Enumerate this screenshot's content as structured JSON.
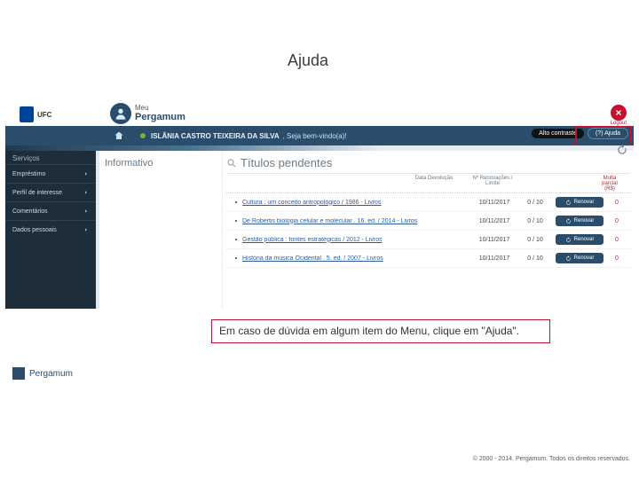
{
  "callout_title": "Ajuda",
  "topbar": {
    "org_code": "UFC",
    "meu_label": "Meu",
    "brand": "Pergamum",
    "logout_label": "Logout"
  },
  "userbar": {
    "user_name": "ISLÂNIA CASTRO TEIXEIRA DA SILVA",
    "welcome": ", Seja bem-vindo(a)!",
    "contrast_label": "Alto contraste",
    "help_label": "(?) Ajuda"
  },
  "sidebar": {
    "section": "Serviços",
    "items": [
      {
        "label": "Empréstimo"
      },
      {
        "label": "Perfil de interesse"
      },
      {
        "label": "Comentários"
      },
      {
        "label": "Dados pessoais"
      }
    ]
  },
  "panels": {
    "info_title": "Informativo",
    "pending_title": "Títulos pendentes",
    "col_date": "Data Devolução",
    "col_renew": "Nº Renovações / Limite",
    "col_multa": "Multa parcial (R$)",
    "renew_label": "Renovar"
  },
  "rows": [
    {
      "title": "Cultura : um conceito antropológico / 1986 - Livros",
      "date": "10/11/2017",
      "ratio": "0 / 10",
      "multa": "0"
    },
    {
      "title": "De Robertis biologia celular e molecular . 16. ed. / 2014 - Livros",
      "date": "10/11/2017",
      "ratio": "0 / 10",
      "multa": "0"
    },
    {
      "title": "Gestão pública : fontes estratégicas / 2012 - Livros",
      "date": "10/11/2017",
      "ratio": "0 / 10",
      "multa": "0"
    },
    {
      "title": "História da música Ocidental . 5. ed. / 2007 - Livros",
      "date": "10/11/2017",
      "ratio": "0 / 10",
      "multa": "0"
    }
  ],
  "callout_text": "Em caso de dúvida em algum item do Menu, clique em \"Ajuda\".",
  "footer": {
    "brand": "Pergamum",
    "copyright": "© 2000 - 2014. Pergamum. Todos os direitos reservados."
  }
}
